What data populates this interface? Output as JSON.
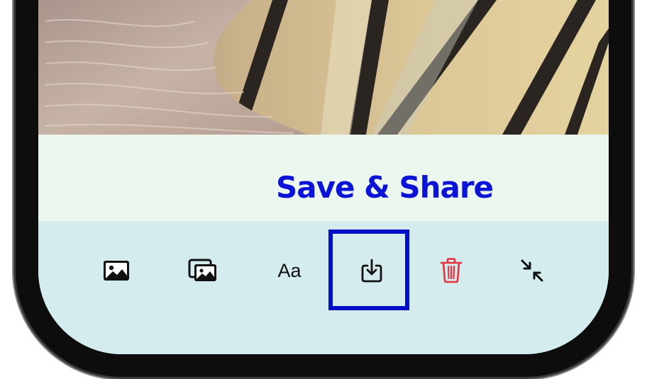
{
  "photo": {
    "description_icon": "photo-preview"
  },
  "caption": {
    "label": "Save & Share",
    "color": "#0b14d6"
  },
  "toolbar": {
    "items": [
      {
        "name": "photo-icon",
        "label": ""
      },
      {
        "name": "photos-stack-icon",
        "label": ""
      },
      {
        "name": "text-style-button",
        "label": "Aa"
      },
      {
        "name": "save-share-icon",
        "label": ""
      },
      {
        "name": "trash-icon",
        "label": ""
      },
      {
        "name": "collapse-icon",
        "label": ""
      }
    ],
    "highlight_color": "#0010c8",
    "delete_color": "#e8323c"
  }
}
